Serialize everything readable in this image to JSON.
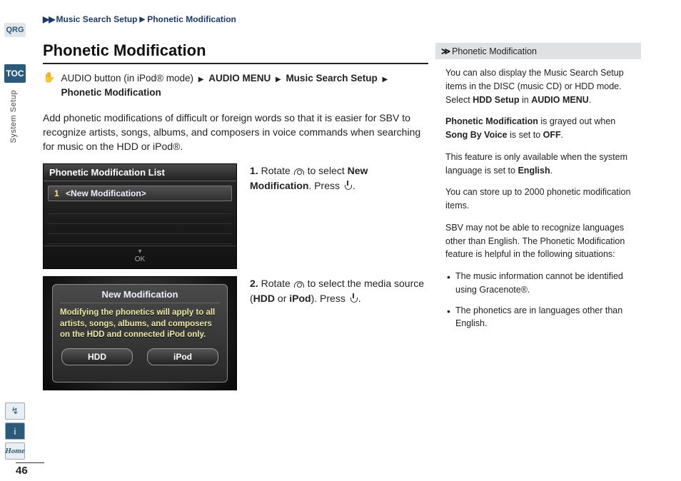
{
  "breadcrumb": {
    "part1": "Music Search Setup",
    "part2": "Phonetic Modification"
  },
  "sidebar": {
    "qrg": "QRG",
    "toc": "TOC",
    "section": "System Setup",
    "home": "Home"
  },
  "page_number": "46",
  "title": "Phonetic Modification",
  "nav": {
    "pre": "AUDIO button (in iPod® mode)",
    "s1": "AUDIO MENU",
    "s2": "Music Search Setup",
    "s3": "Phonetic Modification"
  },
  "intro": "Add phonetic modifications of difficult or foreign words so that it is easier for SBV to recognize artists, songs, albums, and composers in voice commands when searching for music on the HDD or iPod®.",
  "screen1": {
    "title": "Phonetic Modification List",
    "row_num": "1",
    "row_label": "<New Modification>",
    "ok": "OK"
  },
  "step1": {
    "num": "1.",
    "a": "Rotate ",
    "b": " to select ",
    "target": "New Modification",
    "c": ". Press ",
    "d": "."
  },
  "screen2": {
    "title": "New Modification",
    "text": "Modifying the phonetics will apply to all artists, songs, albums, and composers on the HDD and connected iPod only.",
    "btn1": "HDD",
    "btn2": "iPod"
  },
  "step2": {
    "num": "2.",
    "a": "Rotate ",
    "b": " to select the media source (",
    "opt1": "HDD",
    "mid": " or ",
    "opt2": "iPod",
    "c": "). Press ",
    "d": "."
  },
  "info": {
    "head": "Phonetic Modification",
    "p1a": "You can also display the Music Search Setup items in the DISC (music CD) or HDD mode. Select ",
    "p1b": "HDD Setup",
    "p1c": " in ",
    "p1d": "AUDIO MENU",
    "p1e": ".",
    "p2a": "Phonetic Modification",
    "p2b": " is grayed out when ",
    "p2c": "Song By Voice",
    "p2d": " is set to ",
    "p2e": "OFF",
    "p2f": ".",
    "p3a": "This feature is only available when the system language is set to ",
    "p3b": "English",
    "p3c": ".",
    "p4": "You can store up to 2000 phonetic modification items.",
    "p5": "SBV may not be able to recognize languages other than English. The Phonetic Modification feature is helpful in the following situations:",
    "li1": "The music information cannot be identified using Gracenote®.",
    "li2": "The phonetics are in languages other than English."
  }
}
